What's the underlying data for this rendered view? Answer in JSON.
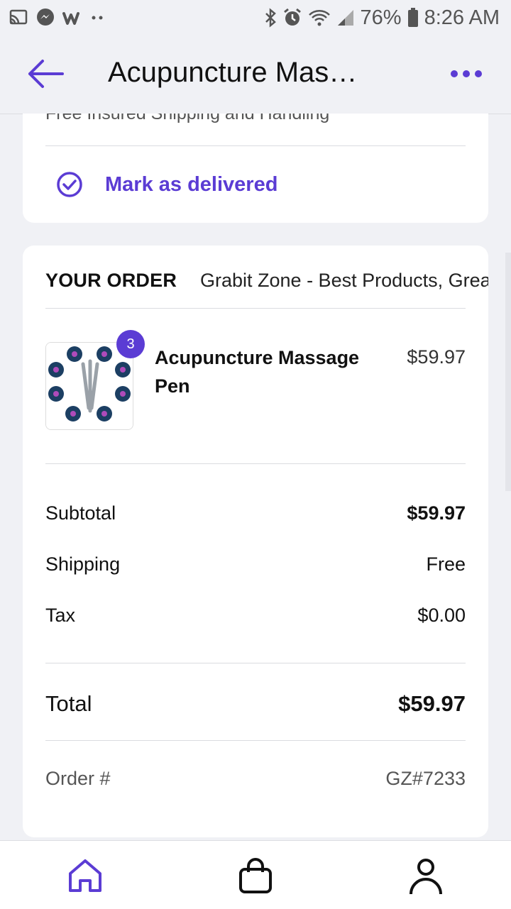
{
  "status_bar": {
    "battery": "76%",
    "time": "8:26 AM",
    "icons_left": [
      "cast-icon",
      "messenger-icon",
      "wish-icon",
      "more-dots-icon"
    ],
    "icons_right": [
      "bluetooth-icon",
      "alarm-icon",
      "wifi-icon",
      "signal-icon",
      "battery-icon"
    ]
  },
  "header": {
    "title": "Acupuncture Mas…",
    "back_icon": "arrow-left-icon",
    "menu_icon": "more-horizontal-icon",
    "accent_color": "#5b3cd4"
  },
  "shipping": {
    "partial_text": "Free Insured Shipping and Handling",
    "mark_delivered_label": "Mark as delivered"
  },
  "order": {
    "heading": "YOUR ORDER",
    "store": "Grabit Zone - Best Products, Grea",
    "item": {
      "name": "Acupuncture Massage Pen",
      "price": "$59.97",
      "quantity": "3"
    },
    "subtotal_label": "Subtotal",
    "subtotal_value": "$59.97",
    "shipping_label": "Shipping",
    "shipping_value": "Free",
    "tax_label": "Tax",
    "tax_value": "$0.00",
    "total_label": "Total",
    "total_value": "$59.97",
    "order_no_label": "Order #",
    "order_no_value": "GZ#7233"
  },
  "bottom_nav": {
    "items": [
      "home-icon",
      "shopping-bag-icon",
      "profile-icon"
    ],
    "active": "home-icon"
  }
}
